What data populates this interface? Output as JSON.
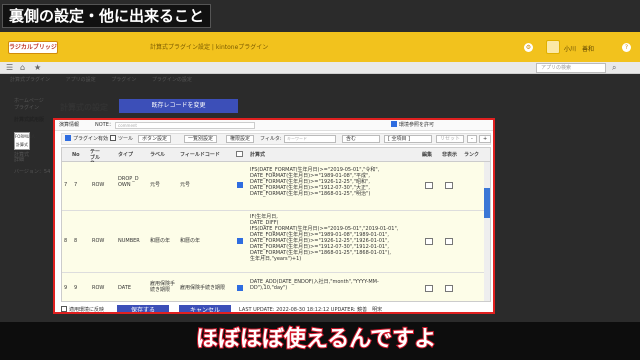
{
  "overlay": {
    "title": "裏側の設定・他に出来ること",
    "subtitle": "ほぼほぼ使えるんですよ"
  },
  "app": {
    "title": "計算式プラグイン設定 | kintoneプラグイン",
    "user_name": "小川　善和",
    "search_placeholder": "アプリの検索",
    "logo_text": "ラジカルブリッジ"
  },
  "breadcrumb": [
    "計算式プラグイン",
    "アプリの設定",
    "プラグイン",
    "プラグインの設定"
  ],
  "sidebar": {
    "items": [
      "ホームページ",
      "プラグイン",
      "計算式試用版",
      "計算式",
      "詳細",
      "バージョン：54"
    ],
    "box_label": "FORMULA\n計算式"
  },
  "page": {
    "title": "計算式の設定",
    "copy_record_button": "既存レコードを変更"
  },
  "panel": {
    "info_label": "演算情報",
    "note_label": "NOTE：",
    "note_placeholder": "comment",
    "allow_label": "環境参照を許可",
    "toolbar": {
      "plugin_enabled": "プラグイン有効",
      "tool": "ツール",
      "button_setting": "ボタン設定",
      "bulk_setting": "一覧別設定",
      "permission_setting": "権限設定",
      "filter_label": "フィルタ:",
      "keyword_placeholder": "キーワード",
      "match_mode": "含む",
      "field_select": "[ 全項目 ]",
      "reset": "リセット",
      "minus": "-",
      "plus": "+"
    },
    "columns": [
      "No",
      "テーブル名",
      "タイプ",
      "ラベル",
      "フィールドコード",
      "",
      "計算式",
      "編集",
      "非表示",
      "ランク"
    ],
    "rows": [
      {
        "idx": "7",
        "no": "7",
        "table": "ROW",
        "type": "DROP_DOWN",
        "label": "元号",
        "code": "元号",
        "formula": "IFS(DATE_FORMAT(生年月日)>=\"2019-05-01\",\"令和\",\nDATE_FORMAT(生年月日)>=\"1989-01-08\",\"平成\",\nDATE_FORMAT(生年月日)>=\"1926-12-25\",\"昭和\",\nDATE_FORMAT(生年月日)>=\"1912-07-30\",\"大正\",\nDATE_FORMAT(生年月日)>=\"1868-01-25\",\"明治\")"
      },
      {
        "idx": "8",
        "no": "8",
        "table": "ROW",
        "type": "NUMBER",
        "label": "和暦の年",
        "code": "和暦の年",
        "formula": "IF(生年月日,\nDATE_DIFF(\nIFS(DATE_FORMAT(生年月日)>=\"2019-05-01\",\"2019-01-01\",\nDATE_FORMAT(生年月日)>=\"1989-01-08\",\"1989-01-01\",\nDATE_FORMAT(生年月日)>=\"1926-12-25\",\"1926-01-01\",\nDATE_FORMAT(生年月日)>=\"1912-07-30\",\"1912-01-01\",\nDATE_FORMAT(生年月日)>=\"1868-01-25\",\"1868-01-01\"),\n生年月日,\"years\")+1)"
      },
      {
        "idx": "9",
        "no": "9",
        "table": "ROW",
        "type": "DATE",
        "label": "雇用保険手続き期限",
        "code": "雇用保険手続き期限",
        "formula": "DATE_ADD(DATE_ENDOF(入社日,\"month\",\"YYYY-MM-DD\"),10,\"day\")"
      }
    ],
    "footer": {
      "apply_env_label": "適用環境に反映",
      "save": "保存する",
      "cancel": "キャンセル",
      "last_update": "LAST UPDATE: 2022-08-30 18:12:12 UPDATER: 鏡善　明宋"
    }
  },
  "colors": {
    "topbar": "#f2c21d",
    "accent_button": "#3c4fb8",
    "highlight_border": "#e02020",
    "subtitle_stroke": "#d4182c"
  }
}
